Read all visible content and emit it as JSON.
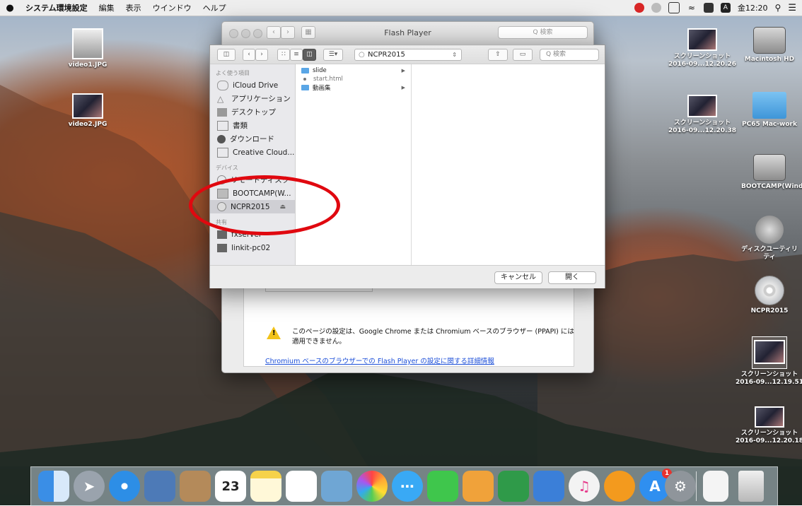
{
  "menubar": {
    "apple": "",
    "items": [
      "システム環境設定",
      "編集",
      "表示",
      "ウインドウ",
      "ヘルプ"
    ],
    "clock": "金12:20"
  },
  "desktop_icons": {
    "video1": "video1.JPG",
    "video2": "video2.JPG",
    "shot1_line1": "スクリーンショット",
    "shot1_line2": "2016-09...12.20.26",
    "macintosh": "Macintosh HD",
    "shot2_line1": "スクリーンショット",
    "shot2_line2": "2016-09...12.20.38",
    "pc65": "PC65 Mac-work",
    "bootcamp": "BOOTCAMP(Windows)",
    "disk_utility": "ディスクユーティリティ",
    "ncpr": "NCPR2015",
    "shot3_line1": "スクリーンショット",
    "shot3_line2": "2016-09...12.19.51",
    "shot4_line1": "スクリーンショット",
    "shot4_line2": "2016-09...12.20.18"
  },
  "flash_window": {
    "title": "Flash Player",
    "search_placeholder": "Q 検索",
    "warning_text": "このページの設定は、Google Chrome または Chromium ベースのブラウザー (PPAPI) には適用できません。",
    "link_text": "Chromium ベースのブラウザーでの Flash Player の設定に関する詳細情報"
  },
  "dialog": {
    "location": "NCPR2015",
    "search_placeholder": "Q 検索",
    "favorites_header": "よく使う項目",
    "favorites": [
      "iCloud Drive",
      "アプリケーション",
      "デスクトップ",
      "書類",
      "ダウンロード",
      "Creative Cloud..."
    ],
    "devices_header": "デバイス",
    "devices": [
      "リモートディスク",
      "BOOTCAMP(W...",
      "NCPR2015"
    ],
    "shared_header": "共有",
    "shared": [
      "fxserver",
      "linkit-pc02"
    ],
    "files": [
      {
        "name": "slide",
        "kind": "folder"
      },
      {
        "name": "start.html",
        "kind": "file"
      },
      {
        "name": "動画集",
        "kind": "folder"
      }
    ],
    "cancel_label": "キャンセル",
    "open_label": "開く"
  },
  "dock": {
    "calendar_day": "23",
    "items": [
      "finder-icon",
      "launchpad-icon",
      "safari-icon",
      "preview-icon",
      "contacts-icon",
      "calendar-icon",
      "notes-icon",
      "reminders-icon",
      "photo-booth-icon",
      "photos-icon",
      "messages-icon",
      "facetime-icon",
      "pages-icon",
      "numbers-icon",
      "keynote-icon",
      "itunes-icon",
      "ibooks-icon",
      "app-store-icon",
      "system-preferences-icon",
      "document-icon",
      "trash-icon"
    ],
    "app_store_badge": "1"
  },
  "colors": {
    "annotation_red": "#e0080f",
    "link_blue": "#1b4ed8",
    "warning_yellow": "#f2c31a"
  }
}
